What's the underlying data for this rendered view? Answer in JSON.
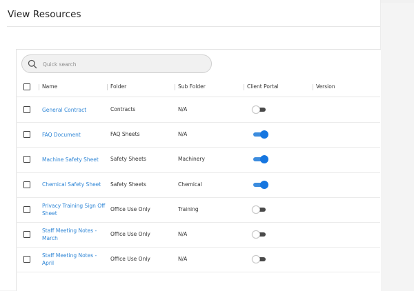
{
  "page": {
    "title": "View Resources"
  },
  "search": {
    "placeholder": "Quick search",
    "value": ""
  },
  "table": {
    "columns": [
      "Name",
      "Folder",
      "Sub Folder",
      "Client Portal",
      "Version"
    ],
    "rows": [
      {
        "name": "General Contract",
        "folder": "Contracts",
        "sub_folder": "N/A",
        "client_portal": false,
        "version": ""
      },
      {
        "name": "FAQ Document",
        "folder": "FAQ Sheets",
        "sub_folder": "N/A",
        "client_portal": true,
        "version": ""
      },
      {
        "name": "Machine Safety Sheet",
        "folder": "Safety Sheets",
        "sub_folder": "Machinery",
        "client_portal": true,
        "version": ""
      },
      {
        "name": "Chemical Safety Sheet",
        "folder": "Safety Sheets",
        "sub_folder": "Chemical",
        "client_portal": true,
        "version": ""
      },
      {
        "name": "Privacy Training Sign Off Sheet",
        "folder": "Office Use Only",
        "sub_folder": "Training",
        "client_portal": false,
        "version": ""
      },
      {
        "name": "Staff Meeting Notes - March",
        "folder": "Office Use Only",
        "sub_folder": "N/A",
        "client_portal": false,
        "version": ""
      },
      {
        "name": "Staff Meeting Notes - April",
        "folder": "Office Use Only",
        "sub_folder": "N/A",
        "client_portal": false,
        "version": ""
      }
    ]
  },
  "colors": {
    "link": "#2f86d6",
    "toggle_on": "#1676e0",
    "toggle_off": "#4a4a4a"
  }
}
